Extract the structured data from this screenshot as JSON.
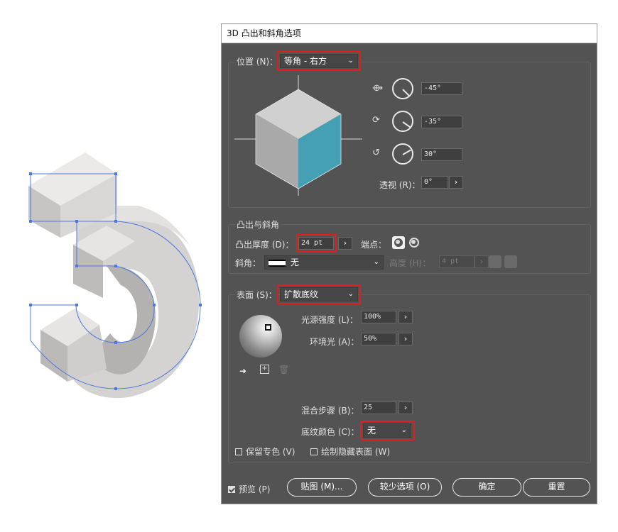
{
  "dialog": {
    "title": "3D 凸出和斜角选项",
    "position": {
      "label": "位置 (N)：",
      "value": "等角 - 右方",
      "x_angle": "-45°",
      "y_angle": "-35°",
      "z_angle": "30°",
      "perspective_label": "透视 (R)：",
      "perspective_value": "0°"
    },
    "extrude": {
      "section_label": "凸出与斜角",
      "depth_label": "凸出厚度 (D)：",
      "depth_value": "24 pt",
      "cap_label": "端点：",
      "bevel_label": "斜角：",
      "bevel_value": "无",
      "height_label": "高度 (H)：",
      "height_value": "4 pt"
    },
    "surface": {
      "label": "表面 (S)：",
      "value": "扩散底纹",
      "light_intensity_label": "光源强度 (L)：",
      "light_intensity_value": "100%",
      "ambient_label": "环境光 (A)：",
      "ambient_value": "50%",
      "blend_steps_label": "混合步骤 (B)：",
      "blend_steps_value": "25",
      "shade_color_label": "底纹颜色 (C)：",
      "shade_color_value": "无",
      "preserve_spot_label": "保留专色 (V)",
      "draw_hidden_label": "绘制隐藏表面 (W)"
    },
    "footer": {
      "preview_label": "预览 (P)",
      "map_art_button": "贴图 (M)...",
      "fewer_options_button": "较少选项 (O)",
      "ok_button": "确定",
      "reset_button": "重置"
    }
  },
  "colors": {
    "dialog_bg": "#535353",
    "highlight": "#e01e1e",
    "cube_right_face": "#45a0b6",
    "selection_blue": "#4a78e0"
  },
  "icons": [
    "x-axis-rotate-icon",
    "y-axis-rotate-icon",
    "z-axis-rotate-icon",
    "cap-on-icon",
    "cap-off-icon",
    "move-light-back-icon",
    "new-light-icon",
    "delete-light-icon",
    "bevel-out-icon",
    "bevel-in-icon"
  ]
}
